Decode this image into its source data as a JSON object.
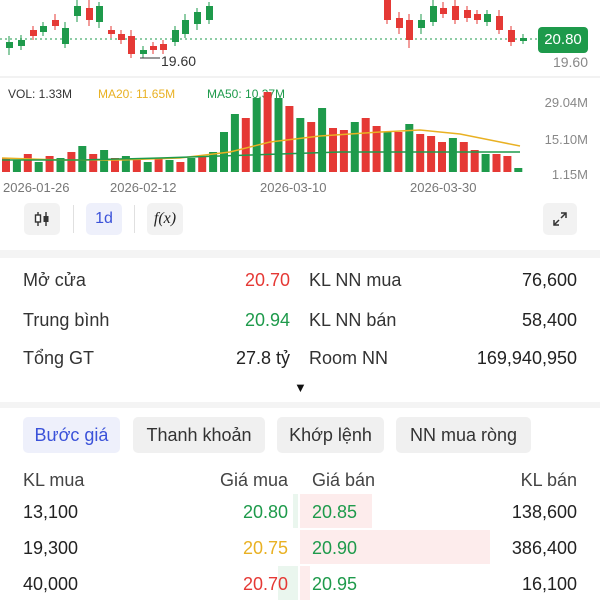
{
  "chart": {
    "current_price_tag": "20.80",
    "right_price_label": "19.60",
    "low_marker_label": "19.60",
    "vol_label": "VOL: 1.33M",
    "ma20_label": "MA20: 11.65M",
    "ma50_label": "MA50: 10.37M",
    "vol_ticks": [
      "29.04M",
      "15.10M",
      "1.15M"
    ],
    "dates": [
      "2026-01-26",
      "2026-02-12",
      "2026-03-10",
      "2026-03-30"
    ],
    "colors": {
      "up": "#1e9a4b",
      "down": "#e53935",
      "ma20": "#e9b123",
      "ma50": "#1e9a4b",
      "accent": "#3b52d9"
    }
  },
  "toolbar": {
    "candle_icon": "candlestick-icon",
    "interval_label": "1d",
    "indicator_label": "f(x)",
    "expand_icon": "expand-icon"
  },
  "stats": {
    "open_label": "Mở cửa",
    "open_value": "20.70",
    "avg_label": "Trung bình",
    "avg_value": "20.94",
    "total_label": "Tổng GT",
    "total_value": "27.8 tỷ",
    "nn_buy_label": "KL NN mua",
    "nn_buy_value": "76,600",
    "nn_sell_label": "KL NN bán",
    "nn_sell_value": "58,400",
    "room_label": "Room NN",
    "room_value": "169,940,950"
  },
  "tabs": [
    "Bước giá",
    "Thanh khoản",
    "Khớp lệnh",
    "NN mua ròng"
  ],
  "orderbook": {
    "headers": [
      "KL mua",
      "Giá mua",
      "Giá bán",
      "KL bán"
    ],
    "rows": [
      {
        "buy_vol": "13,100",
        "buy_price": "20.80",
        "sell_price": "20.85",
        "sell_vol": "138,600"
      },
      {
        "buy_vol": "19,300",
        "buy_price": "20.75",
        "sell_price": "20.90",
        "sell_vol": "386,400"
      },
      {
        "buy_vol": "40,000",
        "buy_price": "20.70",
        "sell_price": "20.95",
        "sell_vol": "16,100"
      }
    ]
  }
}
